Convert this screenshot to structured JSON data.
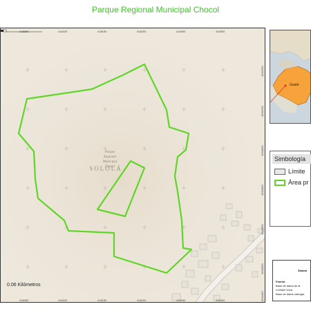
{
  "title": "Parque Regional Municipal Chocol",
  "map": {
    "top_coords": [
      "418050",
      "418100",
      "418150",
      "418200",
      "418250",
      "418300"
    ],
    "bottom_coords": [
      "418050",
      "418100",
      "418150",
      "418200",
      "418250",
      "418300"
    ],
    "right_coords": [
      "1634750",
      "1634700",
      "1634650",
      "1634600",
      "1634550",
      "1634500",
      "1634450"
    ],
    "park_label_lines": [
      "Parque",
      "Regional",
      "Municipal",
      "Chocol"
    ],
    "place_label": "SOLOLÁ",
    "scale_label": "0.06 Kilómetros",
    "boundary_color": "#5ed626",
    "basemap_color": "#ede7dc"
  },
  "inset": {
    "label": "Guate",
    "highlight_color": "#f5a33a"
  },
  "legend": {
    "title": "Simbología",
    "items": [
      {
        "label": "Límite",
        "swatch_fill": "#e8e8e8",
        "swatch_border": "#666666"
      },
      {
        "label": "Área pr",
        "swatch_fill": "#ffffff",
        "swatch_border": "#5ed626"
      }
    ]
  },
  "source": {
    "heading": "Sistem",
    "lines": [
      "Fuente:",
      "Base de datos de la",
      "CONAP 2016",
      "Base de datos cartogra"
    ]
  }
}
